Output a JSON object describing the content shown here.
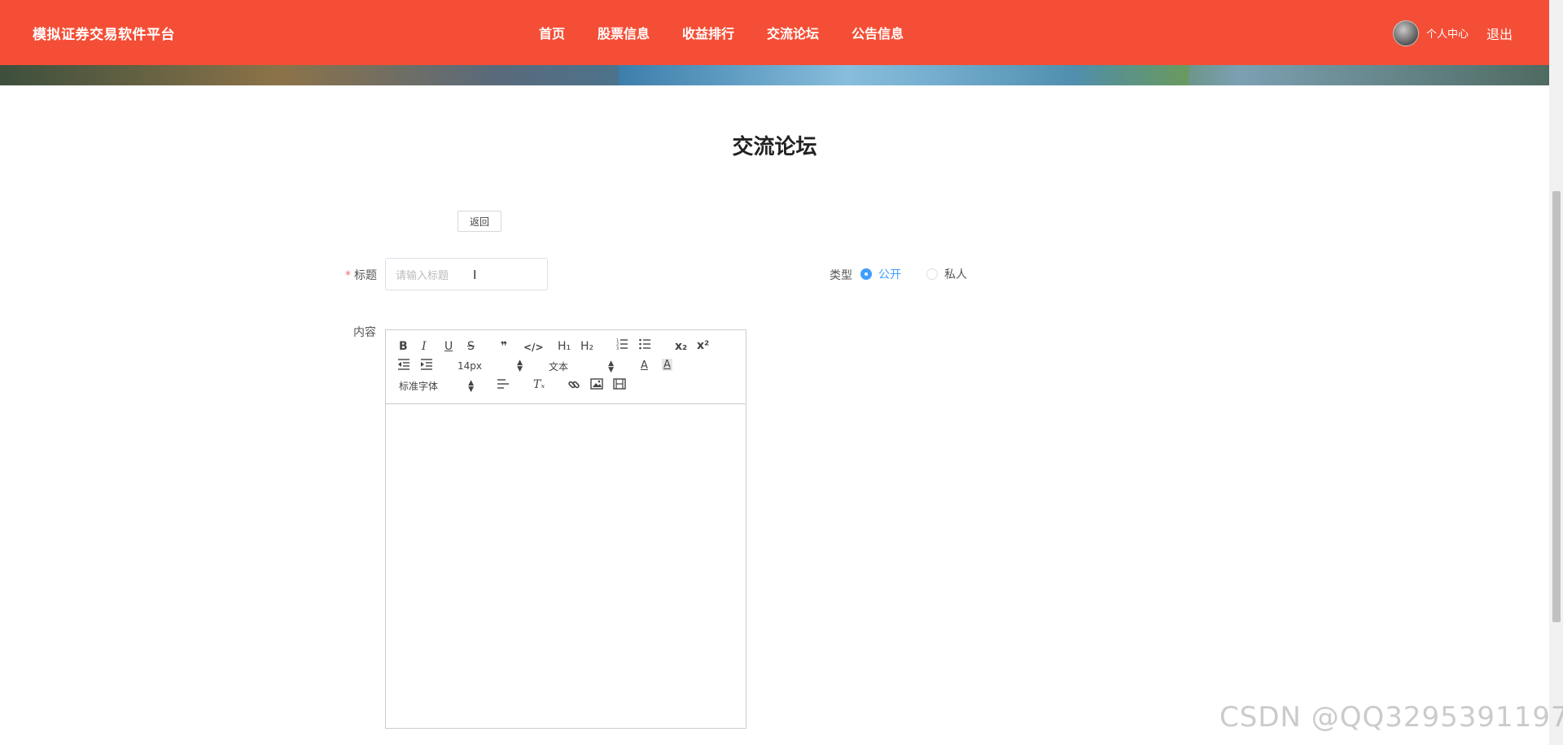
{
  "header": {
    "brand": "模拟证券交易软件平台",
    "nav": [
      "首页",
      "股票信息",
      "收益排行",
      "交流论坛",
      "公告信息"
    ],
    "user_center": "个人中心",
    "logout": "退出",
    "color": "#f54e36"
  },
  "page": {
    "title": "交流论坛",
    "back_label": "返回"
  },
  "form": {
    "title_label": "标题",
    "title_required": "*",
    "title_placeholder": "请输入标题",
    "title_value": "",
    "type_label": "类型",
    "type_options": [
      {
        "label": "公开",
        "checked": true
      },
      {
        "label": "私人",
        "checked": false
      }
    ],
    "content_label": "内容"
  },
  "editor": {
    "font_size": "14px",
    "header_select": "文本",
    "font_family": "标准字体",
    "buttons": [
      "bold",
      "italic",
      "underline",
      "strike",
      "blockquote",
      "code-block",
      "h1",
      "h2",
      "ordered-list",
      "bullet-list",
      "subscript",
      "superscript",
      "outdent",
      "indent",
      "font-color",
      "background-color",
      "align",
      "clean",
      "link",
      "image",
      "video"
    ],
    "labels": {
      "bold": "B",
      "italic": "I",
      "underline": "U",
      "strike": "S",
      "blockquote": "❞",
      "code": "</>",
      "h1": "H₁",
      "h2": "H₂",
      "sub": "x₂",
      "sup": "x²",
      "color": "A",
      "bg": "A",
      "clean": "Tₓ"
    }
  },
  "watermark": "CSDN @QQ3295391197"
}
